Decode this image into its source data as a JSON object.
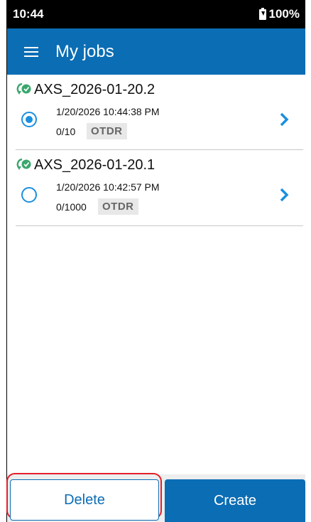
{
  "status_bar": {
    "time": "10:44",
    "battery": "100%"
  },
  "app_bar": {
    "title": "My jobs"
  },
  "jobs": [
    {
      "name": "AXS_2026-01-20.2",
      "date": "1/20/2026 10:44:38 PM",
      "count": "0/10",
      "tag": "OTDR",
      "selected": true
    },
    {
      "name": "AXS_2026-01-20.1",
      "date": "1/20/2026 10:42:57 PM",
      "count": "0/1000",
      "tag": "OTDR",
      "selected": false
    }
  ],
  "actions": {
    "delete_label": "Delete",
    "create_label": "Create"
  },
  "colors": {
    "primary": "#0b6db4",
    "accent": "#1a8fe0",
    "sync_green": "#3aa76d",
    "highlight_red": "#e4202a"
  }
}
